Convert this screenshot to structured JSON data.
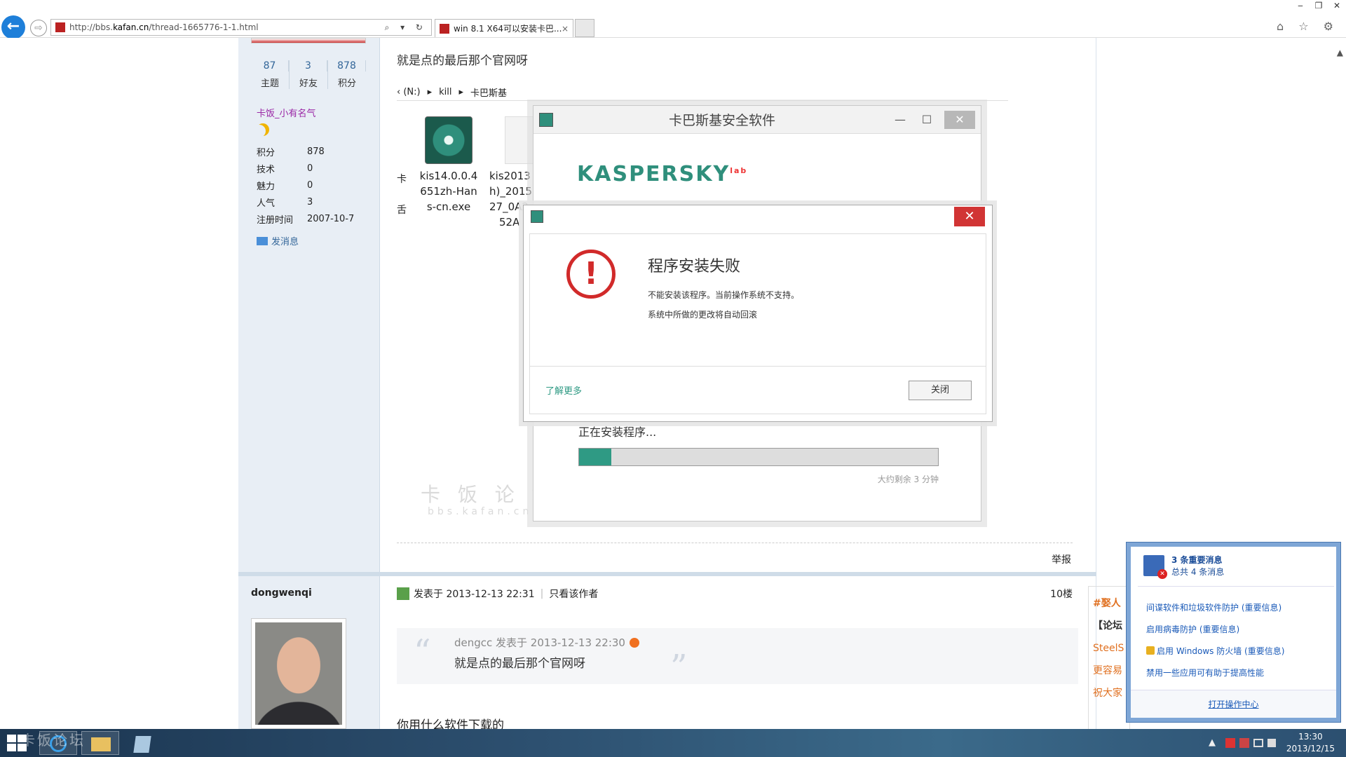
{
  "browser": {
    "url_prefix": "http://bbs.",
    "url_domain": "kafan.cn",
    "url_path": "/thread-1665776-1-1.html",
    "addr_buttons": "⌕ ▾ ↻",
    "tab_title": "win 8.1 X64可以安装卡巴...",
    "tab_close": "×",
    "back": "←",
    "forward": "⇨",
    "window_controls": [
      "‒",
      "❐",
      "✕"
    ],
    "right_icons": "⌂ ☆ ⚙"
  },
  "sidebar": {
    "stats": [
      {
        "num": "87",
        "label": "主题"
      },
      {
        "num": "3",
        "label": "好友"
      },
      {
        "num": "878",
        "label": "积分"
      }
    ],
    "rank": "卡饭_小有名气",
    "profile": [
      {
        "k": "积分",
        "v": "878"
      },
      {
        "k": "技术",
        "v": "0"
      },
      {
        "k": "魅力",
        "v": "0"
      },
      {
        "k": "人气",
        "v": "3"
      },
      {
        "k": "注册时间",
        "v": "2007-10-7"
      }
    ],
    "send_message": "发消息"
  },
  "post1": {
    "text": "就是点的最后那个官网呀",
    "path": [
      "‹ (N:)",
      "▸",
      "kill",
      "▸",
      "卡巴斯基"
    ],
    "file_left": [
      "卡",
      "舌"
    ],
    "file1": [
      "kis14.0.0.4",
      "651zh-Han",
      "s-cn.exe"
    ],
    "file2": [
      "kis2013",
      "h)_2015",
      "27_0A2",
      "52A"
    ],
    "watermark": "卡 饭 论 坛",
    "watermark_url": "bbs.kafan.cn",
    "report": "举报"
  },
  "kaspersky": {
    "title": "卡巴斯基安全软件",
    "logo": "KASPERSKY",
    "logo_mark": "lab",
    "controls": [
      "—",
      "☐",
      "✕"
    ],
    "installing": "正在安装程序...",
    "progress": 0.09,
    "remaining": "大约剩余 3 分钟"
  },
  "error_dialog": {
    "icon": "!",
    "close": "✕",
    "heading": "程序安装失败",
    "msg1": "不能安装该程序。当前操作系统不支持。",
    "msg2": "系统中所做的更改将自动回滚",
    "learn_more": "了解更多",
    "close_button": "关闭"
  },
  "post2": {
    "author": "dongwenqi",
    "posted_at": "发表于 2013-12-13 22:31",
    "only_author": "只看该作者",
    "floor": "10楼",
    "quote_meta": "dengcc 发表于 2013-12-13 22:30",
    "quote_text": "就是点的最后那个官网呀",
    "open_quote": "“",
    "close_quote": "”",
    "text": "你用什么软件下载的"
  },
  "right_ad": [
    "#娶人",
    "【论坛",
    "SteelS",
    "更容易",
    "祝大家"
  ],
  "action_center": {
    "title": "3 条重要消息",
    "subtitle": "总共 4 条消息",
    "items": [
      "间谍软件和垃圾软件防护 (重要信息)",
      "启用病毒防护 (重要信息)",
      "启用 Windows 防火墙 (重要信息)",
      "禁用一些应用可有助于提高性能"
    ],
    "open": "打开操作中心"
  },
  "taskbar": {
    "watermark": "卡饭论坛",
    "tray": "▲",
    "time": "13:30",
    "date": "2013/12/15"
  },
  "colors": {
    "accent": "#2f9a84",
    "error": "#d12a2a",
    "link": "#336699",
    "rank": "#9a28a6"
  }
}
